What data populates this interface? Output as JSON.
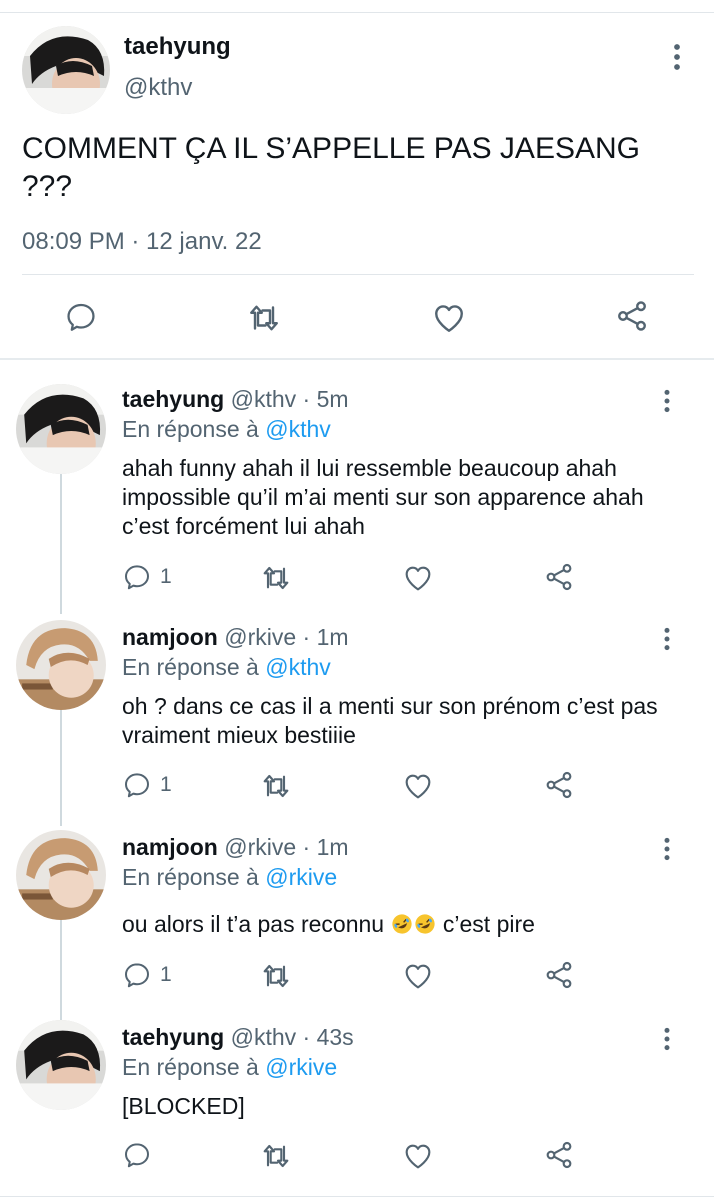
{
  "main_tweet": {
    "name": "taehyung",
    "handle": "@kthv",
    "text": "COMMENT ÇA IL S’APPELLE PAS JAESANG ???",
    "timestamp": "08:09 PM · 12 janv. 22",
    "actions": [
      "reply-icon",
      "retweet-icon",
      "like-icon",
      "share-icon"
    ]
  },
  "replies": [
    {
      "name": "taehyung",
      "meta": "@kthv · 5m",
      "reply_prefix": "En réponse à",
      "reply_to": "@kthv",
      "text": "ahah funny ahah il lui ressemble beaucoup ahah impossible qu’il m’ai menti sur son apparence ahah c’est forcément lui ahah",
      "reply_count": "1"
    },
    {
      "name": "namjoon",
      "meta": "@rkive · 1m",
      "reply_prefix": "En réponse à",
      "reply_to": "@kthv",
      "text": "oh ? dans ce cas il a menti sur son prénom c’est pas vraiment mieux bestiiie",
      "reply_count": "1"
    },
    {
      "name": "namjoon",
      "meta": "@rkive · 1m",
      "reply_prefix": "En réponse à",
      "reply_to": "@rkive",
      "text_before": "ou alors il t’a pas reconnu",
      "emoji": [
        "rolling-on-floor-laughing",
        "rolling-on-floor-laughing"
      ],
      "text_after": " c’est pire",
      "reply_count": "1"
    },
    {
      "name": "taehyung",
      "meta": "@kthv · 43s",
      "reply_prefix": "En réponse à",
      "reply_to": "@rkive",
      "text": "[BLOCKED]",
      "reply_count": ""
    }
  ],
  "colors": {
    "text": "#0f1419",
    "secondary": "#536471",
    "link": "#1d9bf0",
    "border": "#e1e6ea"
  }
}
